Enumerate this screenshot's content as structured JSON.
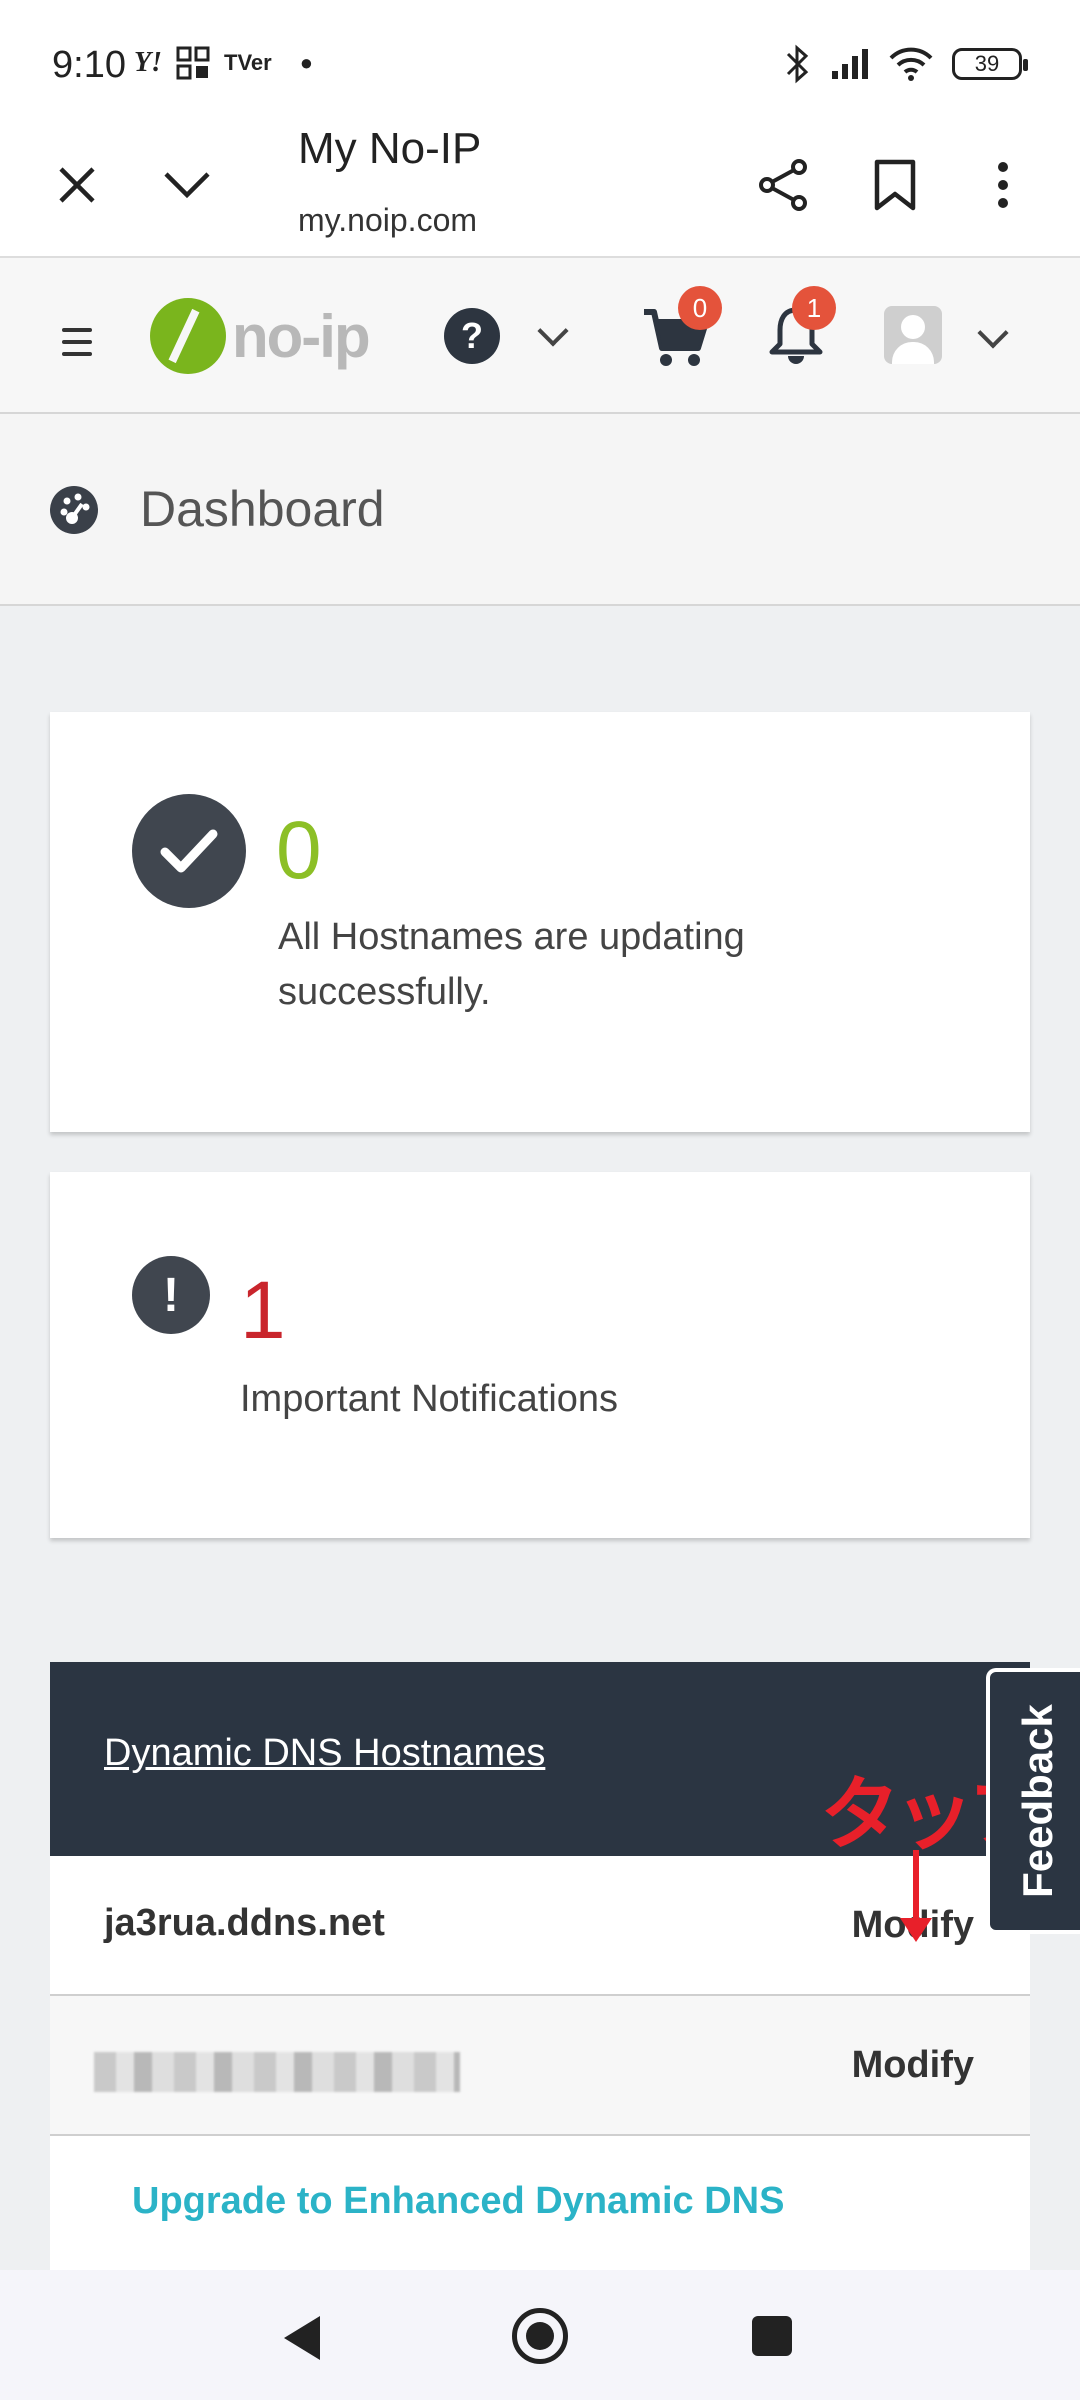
{
  "status_bar": {
    "time": "9:10",
    "left_icons": [
      "Y!",
      "TVer"
    ],
    "battery": "39"
  },
  "browser": {
    "title": "My No-IP",
    "url": "my.noip.com"
  },
  "site_nav": {
    "logo_text": "no-ip",
    "help_label": "?",
    "cart_count": "0",
    "notification_count": "1"
  },
  "dashboard": {
    "title": "Dashboard"
  },
  "hostname_card": {
    "count": "0",
    "text": "All Hostnames are updating successfully.",
    "color": "#8cbf26"
  },
  "notification_card": {
    "count": "1",
    "text": "Important Notifications",
    "color": "#c9252c"
  },
  "dns_table": {
    "title": "Dynamic DNS Hostnames",
    "rows": [
      {
        "hostname": "ja3rua.ddns.net",
        "action": "Modify"
      },
      {
        "hostname": "",
        "action": "Modify"
      }
    ],
    "upgrade_link": "Upgrade to Enhanced Dynamic DNS"
  },
  "annotation": {
    "text": "タップ"
  },
  "feedback_tab": {
    "label": "Feedback"
  }
}
